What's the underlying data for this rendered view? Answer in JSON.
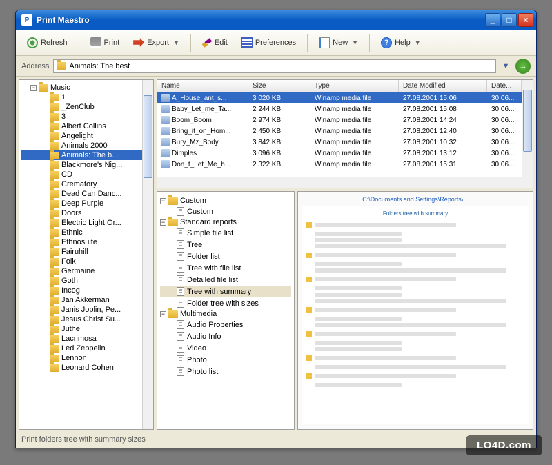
{
  "window": {
    "title": "Print Maestro"
  },
  "toolbar": {
    "refresh": "Refresh",
    "print": "Print",
    "export": "Export",
    "edit": "Edit",
    "prefs": "Preferences",
    "new": "New",
    "help": "Help"
  },
  "address": {
    "label": "Address",
    "value": "Animals: The best"
  },
  "tree": {
    "root": "Music",
    "items": [
      {
        "label": "1",
        "exp": false
      },
      {
        "label": "_ZenClub",
        "exp": false
      },
      {
        "label": "3",
        "exp": false
      },
      {
        "label": "Albert Collins",
        "exp": false
      },
      {
        "label": "Angelight",
        "exp": false
      },
      {
        "label": "Animals 2000",
        "exp": false
      },
      {
        "label": "Animals: The b...",
        "exp": false,
        "sel": true
      },
      {
        "label": "Blackmore's Nig...",
        "exp": false
      },
      {
        "label": "CD",
        "exp": false
      },
      {
        "label": "Crematory",
        "exp": false
      },
      {
        "label": "Dead Can Danc...",
        "exp": false
      },
      {
        "label": "Deep Purple",
        "exp": false
      },
      {
        "label": "Doors",
        "exp": false
      },
      {
        "label": "Electric Light Or...",
        "exp": false
      },
      {
        "label": "Ethnic",
        "exp": false
      },
      {
        "label": "Ethnosuite",
        "exp": false
      },
      {
        "label": "Fairuhill",
        "exp": false
      },
      {
        "label": "Folk",
        "exp": false
      },
      {
        "label": "Germaine",
        "exp": false
      },
      {
        "label": "Goth",
        "exp": false
      },
      {
        "label": "Incog",
        "exp": false
      },
      {
        "label": "Jan Akkerman",
        "exp": false
      },
      {
        "label": "Janis Joplin, Pe...",
        "exp": false
      },
      {
        "label": "Jesus Christ Su...",
        "exp": false
      },
      {
        "label": "Juthe",
        "exp": false
      },
      {
        "label": "Lacrimosa",
        "exp": false
      },
      {
        "label": "Led Zeppelin",
        "exp": false
      },
      {
        "label": "Lennon",
        "exp": false
      },
      {
        "label": "Leonard Cohen",
        "exp": false
      }
    ]
  },
  "filelist": {
    "columns": [
      "Name",
      "Size",
      "Type",
      "Date Modified",
      "Date..."
    ],
    "rows": [
      {
        "name": "A_House_ant_s...",
        "size": "3 020 KB",
        "type": "Winamp media file",
        "date": "27.08.2001 15:06",
        "d2": "30.06..."
      },
      {
        "name": "Baby_Let_me_Ta...",
        "size": "2 244 KB",
        "type": "Winamp media file",
        "date": "27.08.2001 15:08",
        "d2": "30.06..."
      },
      {
        "name": "Boom_Boom",
        "size": "2 974 KB",
        "type": "Winamp media file",
        "date": "27.08.2001 14:24",
        "d2": "30.06..."
      },
      {
        "name": "Bring_it_on_Hom...",
        "size": "2 450 KB",
        "type": "Winamp media file",
        "date": "27.08.2001 12:40",
        "d2": "30.06..."
      },
      {
        "name": "Bury_Mz_Body",
        "size": "3 842 KB",
        "type": "Winamp media file",
        "date": "27.08.2001 10:32",
        "d2": "30.06..."
      },
      {
        "name": "Dimples",
        "size": "3 096 KB",
        "type": "Winamp media file",
        "date": "27.08.2001 13:12",
        "d2": "30.06..."
      },
      {
        "name": "Don_t_Let_Me_b...",
        "size": "2 322 KB",
        "type": "Winamp media file",
        "date": "27.08.2001 15:31",
        "d2": "30.06..."
      }
    ]
  },
  "reports": {
    "groups": [
      {
        "title": "Custom",
        "items": [
          {
            "label": "Custom"
          }
        ]
      },
      {
        "title": "Standard reports",
        "items": [
          {
            "label": "Simple file list"
          },
          {
            "label": "Tree"
          },
          {
            "label": "Folder list"
          },
          {
            "label": "Tree with file list"
          },
          {
            "label": "Detailed file list"
          },
          {
            "label": "Tree with summary",
            "sel": true
          },
          {
            "label": "Folder tree with sizes"
          }
        ]
      },
      {
        "title": "Multimedia",
        "items": [
          {
            "label": "Audio Properties"
          },
          {
            "label": "Audio Info"
          },
          {
            "label": "Video"
          },
          {
            "label": "Photo"
          },
          {
            "label": "Photo list"
          }
        ]
      }
    ]
  },
  "preview": {
    "title": "Folders tree with summary",
    "subtitle": "C:\\Documents and Settings\\Reports\\..."
  },
  "status": "Print folders tree with summary sizes",
  "watermark": "LO4D.com"
}
